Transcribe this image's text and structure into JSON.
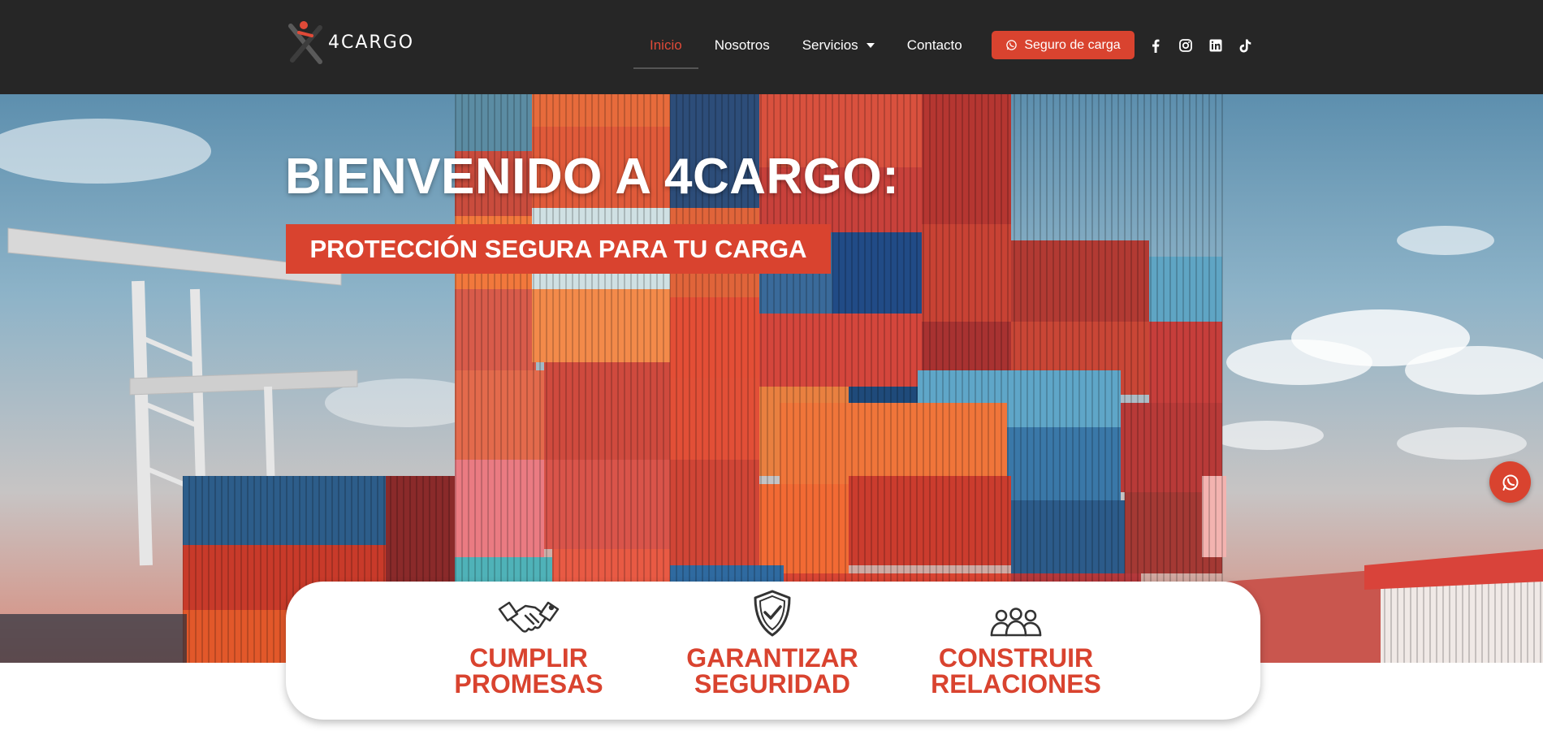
{
  "brand": {
    "logo_text": "4CARGO",
    "logo_icon": "runner-x-logo-icon"
  },
  "nav": {
    "items": [
      {
        "label": "Inicio",
        "active": true
      },
      {
        "label": "Nosotros",
        "active": false
      },
      {
        "label": "Servicios",
        "active": false,
        "has_dropdown": true
      },
      {
        "label": "Contacto",
        "active": false
      }
    ]
  },
  "cta": {
    "label": "Seguro de carga",
    "icon": "whatsapp-icon"
  },
  "socials": [
    {
      "name": "facebook-icon"
    },
    {
      "name": "instagram-icon"
    },
    {
      "name": "linkedin-icon"
    },
    {
      "name": "tiktok-icon"
    }
  ],
  "hero": {
    "title": "BIENVENIDO A 4CARGO:",
    "subtitle": "PROTECCIÓN SEGURA PARA TU CARGA",
    "background": "stacked-shipping-containers-image"
  },
  "values": [
    {
      "icon": "handshake-icon",
      "line1": "CUMPLIR",
      "line2": "PROMESAS"
    },
    {
      "icon": "shield-check-icon",
      "line1": "GARANTIZAR",
      "line2": "SEGURIDAD"
    },
    {
      "icon": "people-group-icon",
      "line1": "CONSTRUIR",
      "line2": "RELACIONES"
    }
  ],
  "floating_button": {
    "icon": "whatsapp-icon"
  },
  "colors": {
    "accent": "#d9432f",
    "header_bg": "#262626",
    "active_nav": "#e04a38"
  }
}
